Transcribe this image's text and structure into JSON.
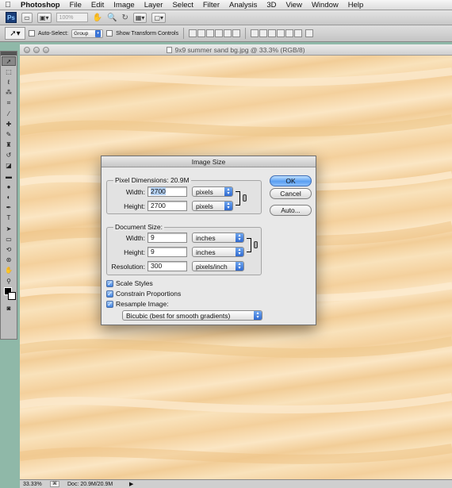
{
  "menubar": {
    "app_name": "Photoshop",
    "items": [
      "File",
      "Edit",
      "Image",
      "Layer",
      "Select",
      "Filter",
      "Analysis",
      "3D",
      "View",
      "Window",
      "Help"
    ]
  },
  "appbar": {
    "logo": "Ps",
    "zoom": "100%"
  },
  "options_bar": {
    "auto_select_label": "Auto-Select:",
    "auto_select_value": "Group",
    "transform_label": "Show Transform Controls"
  },
  "document": {
    "title": "9x9 summer sand bg.jpg @ 33.3% (RGB/8)",
    "status_zoom": "33.33%",
    "status_doc": "Doc: 20.9M/20.9M"
  },
  "dialog": {
    "title": "Image Size",
    "pixel_dimensions_label": "Pixel Dimensions:",
    "pixel_dimensions_value": "20.9M",
    "width_label": "Width:",
    "height_label": "Height:",
    "px_width": "2700",
    "px_height": "2700",
    "px_width_unit": "pixels",
    "px_height_unit": "pixels",
    "document_size_label": "Document Size:",
    "doc_width_label": "Width:",
    "doc_height_label": "Height:",
    "resolution_label": "Resolution:",
    "doc_width": "9",
    "doc_height": "9",
    "resolution": "300",
    "doc_width_unit": "inches",
    "doc_height_unit": "inches",
    "resolution_unit": "pixels/inch",
    "ok_label": "OK",
    "cancel_label": "Cancel",
    "auto_label": "Auto...",
    "scale_styles_label": "Scale Styles",
    "constrain_label": "Constrain Proportions",
    "resample_label": "Resample Image:",
    "resample_method": "Bicubic (best for smooth gradients)"
  }
}
